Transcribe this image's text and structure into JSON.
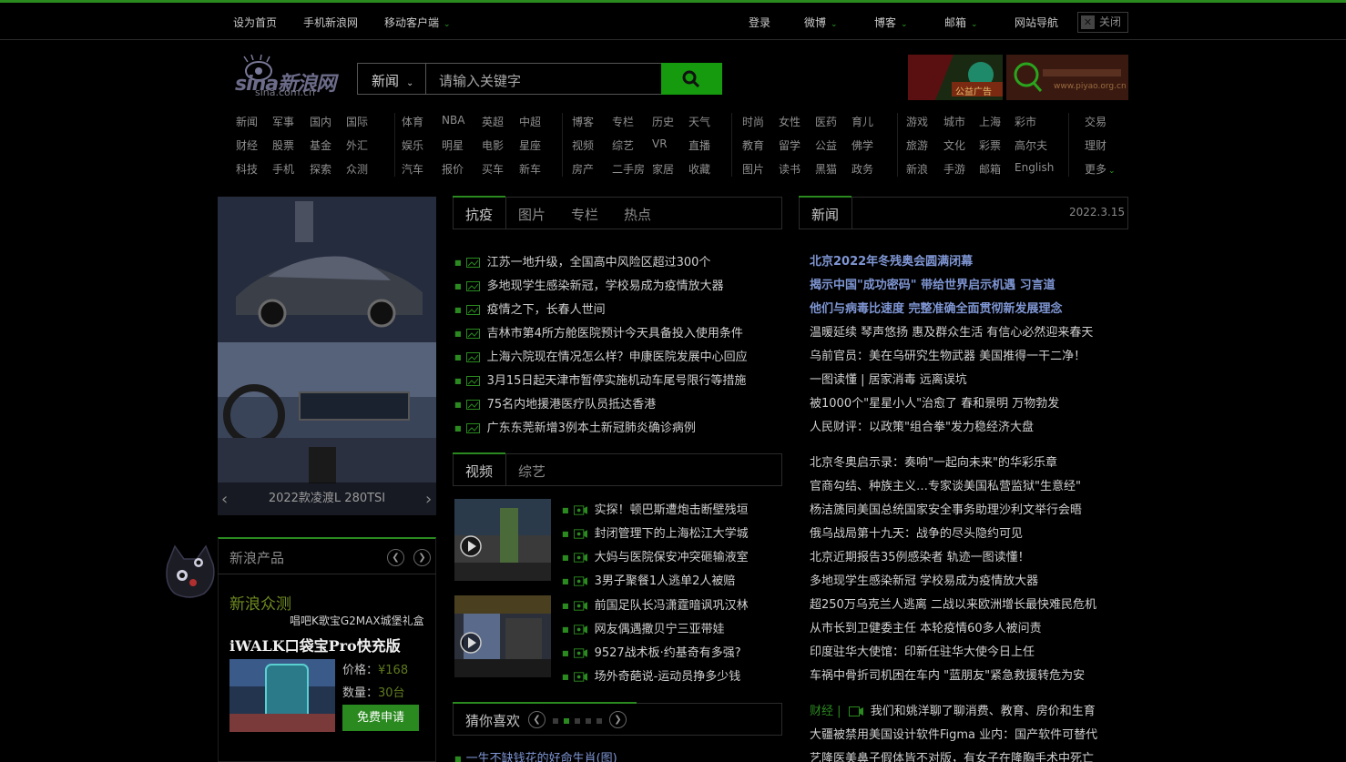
{
  "topbar": {
    "left": [
      "设为首页",
      "手机新浪网",
      "移动客户端"
    ],
    "right": [
      "登录",
      "微博",
      "博客",
      "邮箱",
      "网站导航"
    ],
    "close": "关闭"
  },
  "logo": {
    "main": "sina新浪网",
    "sub": "sina.com.cn"
  },
  "search": {
    "category": "新闻",
    "placeholder": "请输入关键字"
  },
  "ads": [
    {
      "label": "公益广告"
    },
    {
      "label": "www.piyao.org.cn"
    }
  ],
  "nav": {
    "g1": [
      [
        "新闻",
        "军事",
        "国内",
        "国际"
      ],
      [
        "财经",
        "股票",
        "基金",
        "外汇"
      ],
      [
        "科技",
        "手机",
        "探索",
        "众测"
      ]
    ],
    "g2": [
      [
        "体育",
        "NBA",
        "英超",
        "中超"
      ],
      [
        "娱乐",
        "明星",
        "电影",
        "星座"
      ],
      [
        "汽车",
        "报价",
        "买车",
        "新车"
      ]
    ],
    "g3": [
      [
        "博客",
        "专栏",
        "历史",
        "天气"
      ],
      [
        "视频",
        "综艺",
        "VR",
        "直播"
      ],
      [
        "房产",
        "二手房",
        "家居",
        "收藏"
      ]
    ],
    "g4": [
      [
        "时尚",
        "女性",
        "医药",
        "育儿"
      ],
      [
        "教育",
        "留学",
        "公益",
        "佛学"
      ],
      [
        "图片",
        "读书",
        "黑猫",
        "政务"
      ]
    ],
    "g5": [
      [
        "游戏",
        "城市",
        "上海",
        "彩市"
      ],
      [
        "旅游",
        "文化",
        "彩票",
        "高尔夫"
      ],
      [
        "新浪",
        "手游",
        "邮箱",
        "English"
      ]
    ],
    "g6": [
      "交易",
      "理财",
      "更多"
    ]
  },
  "carousel": {
    "caption": "2022款凌渡L 280TSI"
  },
  "products": {
    "title": "新浪产品",
    "zc_title": "新浪众测",
    "zc_sub": "唱吧K歌宝G2MAX城堡礼盒",
    "product_name": "iWALK口袋宝Pro快充版",
    "price_label": "价格：",
    "price_value": "¥168",
    "qty_label": "数量：",
    "qty_value": "30台",
    "apply": "免费申请"
  },
  "news_tabs": [
    "抗疫",
    "图片",
    "专栏",
    "热点"
  ],
  "news_items": [
    "江苏一地升级，全国高中风险区超过300个",
    "多地现学生感染新冠，学校易成为疫情放大器",
    "疫情之下，长春人世间",
    "吉林市第4所方舱医院预计今天具备投入使用条件",
    "上海六院现在情况怎么样？申康医院发展中心回应",
    "3月15日起天津市暂停实施机动车尾号限行等措施",
    "75名内地援港医疗队员抵达香港",
    "广东东莞新增3例本土新冠肺炎确诊病例"
  ],
  "video_tabs": [
    "视频",
    "综艺"
  ],
  "video_items_a": [
    "实探！顿巴斯遭炮击断壁残垣",
    "封闭管理下的上海松江大学城",
    "大妈与医院保安冲突砸输液室",
    "3男子聚餐1人逃单2人被赔"
  ],
  "video_items_b": [
    "前国足队长冯潇霆暗讽巩汉林",
    "网友偶遇撒贝宁三亚带娃",
    "9527战术板·约基奇有多强?",
    "场外奇葩说-运动员挣多少钱"
  ],
  "guess": {
    "title": "猜你喜欢"
  },
  "bottom_item": "一生不缺钱花的好命生肖(图)",
  "right": {
    "tab": "新闻",
    "date": "2022.3.15",
    "heads": [
      "北京2022年冬残奥会圆满闭幕",
      "揭示中国\"成功密码\" 带给世界启示机遇 习言道",
      "他们与病毒比速度 完整准确全面贯彻新发展理念"
    ],
    "items1": [
      "温暖延续 琴声悠扬 惠及群众生活 有信心必然迎来春天",
      "乌前官员：美在乌研究生物武器 美国推得一干二净！",
      "一图读懂 | 居家消毒 远离误坑",
      "被1000个\"星星小人\"治愈了 春和景明 万物勃发",
      "人民财评：以政策\"组合拳\"发力稳经济大盘"
    ],
    "items2": [
      "北京冬奥启示录：奏响\"一起向未来\"的华彩乐章",
      "官商勾结、种族主义…专家谈美国私营监狱\"生意经\"",
      "杨洁篪同美国总统国家安全事务助理沙利文举行会晤",
      "俄乌战局第十九天：战争的尽头隐约可见",
      "北京近期报告35例感染者 轨迹一图读懂！",
      "多地现学生感染新冠 学校易成为疫情放大器",
      "超250万乌克兰人逃离 二战以来欧洲增长最快难民危机",
      "从市长到卫健委主任 本轮疫情60多人被问责",
      "印度驻华大使馆：印新任驻华大使今日上任",
      "车祸中骨折司机困在车内 \"蓝朋友\"紧急救援转危为安"
    ],
    "finance_label": "财经 |",
    "finance_item": "我们和姚洋聊了聊消费、教育、房价和生育",
    "items3": [
      "大疆被禁用美国设计软件Figma 业内：国产软件可替代",
      "艺隆医美鼻子假体皆不对版，有女子在隆胸手术中死亡"
    ]
  },
  "colors": {
    "accent": "#2a8a1f",
    "link_blue": "#7f96d4",
    "bg": "#000000"
  }
}
